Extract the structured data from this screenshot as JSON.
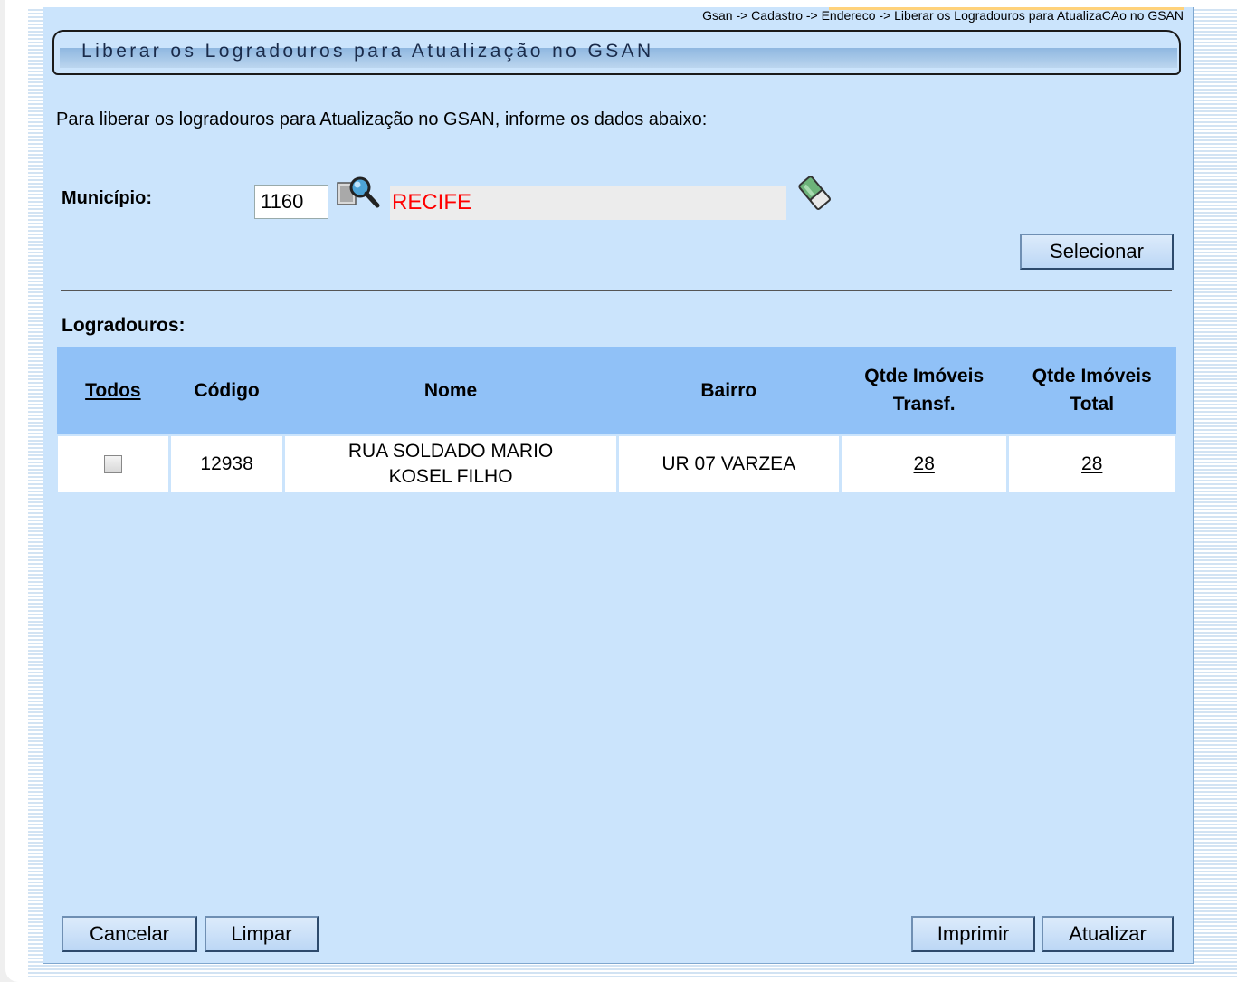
{
  "breadcrumb": "Gsan -> Cadastro -> Endereco -> Liberar os Logradouros para AtualizaCAo no GSAN",
  "title": "Liberar os Logradouros para Atualização no GSAN",
  "intro": "Para liberar os logradouros para Atualização no GSAN, informe os dados abaixo:",
  "municipio": {
    "label": "Município:",
    "code": "1160",
    "name": "RECIFE",
    "search_icon": "search-icon",
    "clear_icon": "eraser-icon"
  },
  "buttons": {
    "selecionar": "Selecionar",
    "cancelar": "Cancelar",
    "limpar": "Limpar",
    "imprimir": "Imprimir",
    "atualizar": "Atualizar"
  },
  "logradouros": {
    "label": "Logradouros:",
    "headers": [
      "Todos",
      "Código",
      "Nome",
      "Bairro",
      "Qtde Imóveis Transf.",
      "Qtde Imóveis Total"
    ],
    "rows": [
      {
        "checked": false,
        "codigo": "12938",
        "nome": "RUA SOLDADO MARIO KOSEL FILHO",
        "bairro": "UR 07 VARZEA",
        "qtde_transf": "28",
        "qtde_total": "28"
      }
    ]
  },
  "colors": {
    "panel": "#cbe4fc",
    "table_header": "#90c1f7",
    "municipio_name": "#ff0000"
  }
}
